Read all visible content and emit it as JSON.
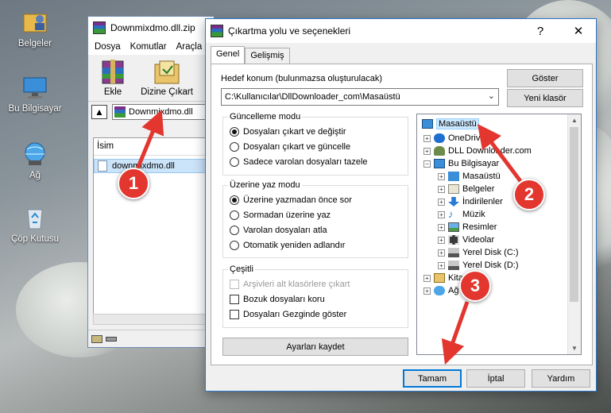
{
  "desktop": {
    "icons": [
      {
        "label": "Belgeler",
        "icon": "user-folder-icon"
      },
      {
        "label": "Bu Bilgisayar",
        "icon": "computer-icon"
      },
      {
        "label": "Ağ",
        "icon": "network-icon"
      },
      {
        "label": "Çöp Kutusu",
        "icon": "recycle-bin-icon"
      }
    ]
  },
  "winrar": {
    "title": "Downmixdmo.dll.zip",
    "menu": [
      "Dosya",
      "Komutlar",
      "Araçla"
    ],
    "toolbar": {
      "add_label": "Ekle",
      "extract_label": "Dizine Çıkart"
    },
    "address": "Downmixdmo.dll",
    "list_header": "İsim",
    "file_name": "downmixdmo.dll"
  },
  "dialog": {
    "title": "Çıkartma yolu ve seçenekleri",
    "help_glyph": "?",
    "close_glyph": "✕",
    "tabs": [
      "Genel",
      "Gelişmiş"
    ],
    "destination_label": "Hedef konum (bulunmazsa oluşturulacak)",
    "destination_value": "C:\\Kullanıcılar\\DllDownloader_com\\Masaüstü",
    "show_button": "Göster",
    "new_folder_button": "Yeni klasör",
    "update_mode": {
      "title": "Güncelleme modu",
      "options": [
        "Dosyaları çıkart ve değiştir",
        "Dosyaları çıkart ve güncelle",
        "Sadece varolan dosyaları tazele"
      ],
      "selected": 0
    },
    "overwrite_mode": {
      "title": "Üzerine yaz modu",
      "options": [
        "Üzerine yazmadan önce sor",
        "Sormadan üzerine yaz",
        "Varolan dosyaları atla",
        "Otomatik yeniden adlandır"
      ],
      "selected": 0
    },
    "misc": {
      "title": "Çeşitli",
      "options": [
        "Arşivleri alt klasörlere çıkart",
        "Bozuk dosyaları koru",
        "Dosyaları Gezginde göster"
      ]
    },
    "save_settings_button": "Ayarları kaydet",
    "tree": [
      {
        "label": "Masaüstü",
        "icon": "desktop-folder-icon",
        "selected": true
      },
      {
        "label": "OneDrive",
        "icon": "onedrive-icon"
      },
      {
        "label": "DLL Downloader.com",
        "icon": "user-icon"
      },
      {
        "label": "Bu Bilgisayar",
        "icon": "computer-icon"
      },
      {
        "label": "Masaüstü",
        "icon": "desktop-folder-icon"
      },
      {
        "label": "Belgeler",
        "icon": "documents-icon"
      },
      {
        "label": "İndirilenler",
        "icon": "downloads-icon"
      },
      {
        "label": "Müzik",
        "icon": "music-icon"
      },
      {
        "label": "Resimler",
        "icon": "pictures-icon"
      },
      {
        "label": "Videolar",
        "icon": "videos-icon"
      },
      {
        "label": "Yerel Disk (C:)",
        "icon": "drive-icon"
      },
      {
        "label": "Yerel Disk (D:)",
        "icon": "drive-icon"
      },
      {
        "label": "Kitaplık",
        "icon": "library-icon"
      },
      {
        "label": "Ağ",
        "icon": "network-icon"
      }
    ],
    "ok_button": "Tamam",
    "cancel_button": "İptal",
    "help_button": "Yardım"
  },
  "annotations": {
    "step1": "1",
    "step2": "2",
    "step3": "3",
    "color": "#e2362f"
  }
}
